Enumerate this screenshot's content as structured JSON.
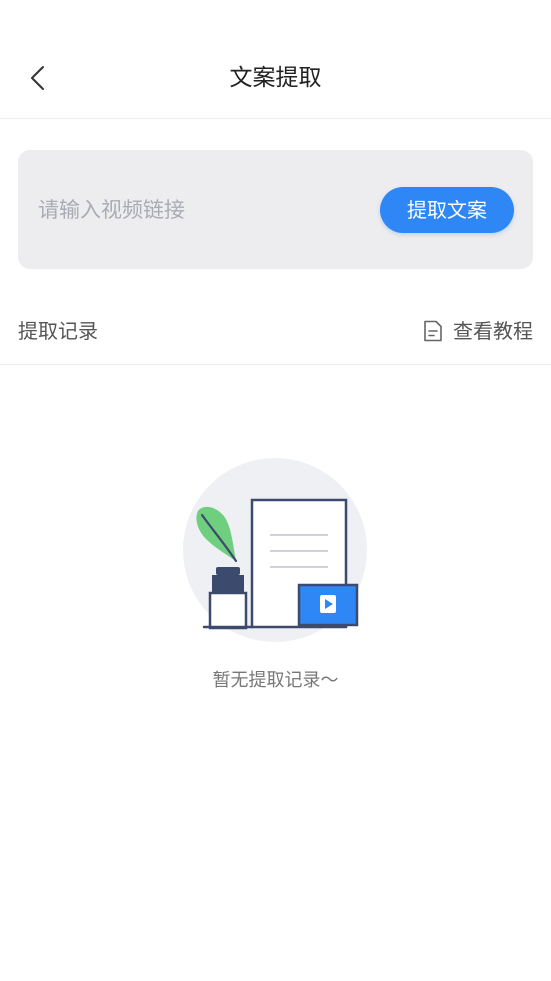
{
  "header": {
    "title": "文案提取"
  },
  "extract": {
    "input_value": "",
    "input_placeholder": "请输入视频链接",
    "button_label": "提取文案"
  },
  "records": {
    "title": "提取记录",
    "tutorial_label": "查看教程",
    "empty_text": "暂无提取记录～"
  },
  "colors": {
    "accent": "#2f87f5",
    "card_background": "#ededef",
    "leaf_green": "#6fcf7f",
    "line_navy": "#3c4a6e"
  },
  "icons": {
    "back": "chevron-left-icon",
    "tutorial": "document-icon",
    "illustration": "empty-records-illustration"
  }
}
